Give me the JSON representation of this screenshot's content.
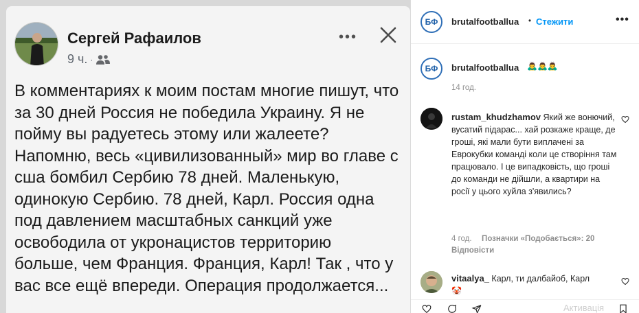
{
  "post": {
    "author": "Сергей Рафаилов",
    "time": "9 ч.",
    "more_icon": "more-horizontal-icon",
    "close_icon": "close-icon",
    "audience_icon": "friends-icon",
    "text": "В комментариях к моим постам многие пишут, что за 30 дней Россия не победила Украину. Я не пойму вы радуетесь этому или жалеете? Напомню, весь «цивилизованный» мир во главе с сша бомбил Сербию 78 дней. Маленькую, одинокую Сербию. 78 дней, Карл. Россия одна под давлением масштабных санкций уже освободила от укронацистов территорию больше, чем Франция. Франция, Карл! Так , что у вас все ещё впереди. Операция продолжается..."
  },
  "header": {
    "username": "brutalfootballua",
    "separator": "•",
    "follow_label": "Стежити",
    "more_icon": "more-horizontal-icon",
    "logo_text": "БФ"
  },
  "caption": {
    "username": "brutalfootballua",
    "emojis": "🙇‍♂️🙇‍♂️🙇‍♂️",
    "time": "14 год."
  },
  "comments": [
    {
      "username": "rustam_khudzhamov",
      "text": "Який же вонючий, вусатий підарас... хай розкаже краще, де гроші, які мали бути виплачені за Еврокубки команді коли це створіння там працювало. І це випадковість, що гроші до команди не дійшли, а квартири на росії у цього хуйла з'явились?",
      "time": "4 год.",
      "likes": "Позначки «Подобається»: 20",
      "reply": "Відповісти"
    },
    {
      "username": "vitaalya_",
      "text": "Карл, ти далбайоб, Карл",
      "emoji": "🤡"
    }
  ],
  "watermark": "Активація Windows",
  "colors": {
    "follow": "#0095f6",
    "logo_ring": "#2f6fb7",
    "meta_gray": "#8e8e8e"
  }
}
